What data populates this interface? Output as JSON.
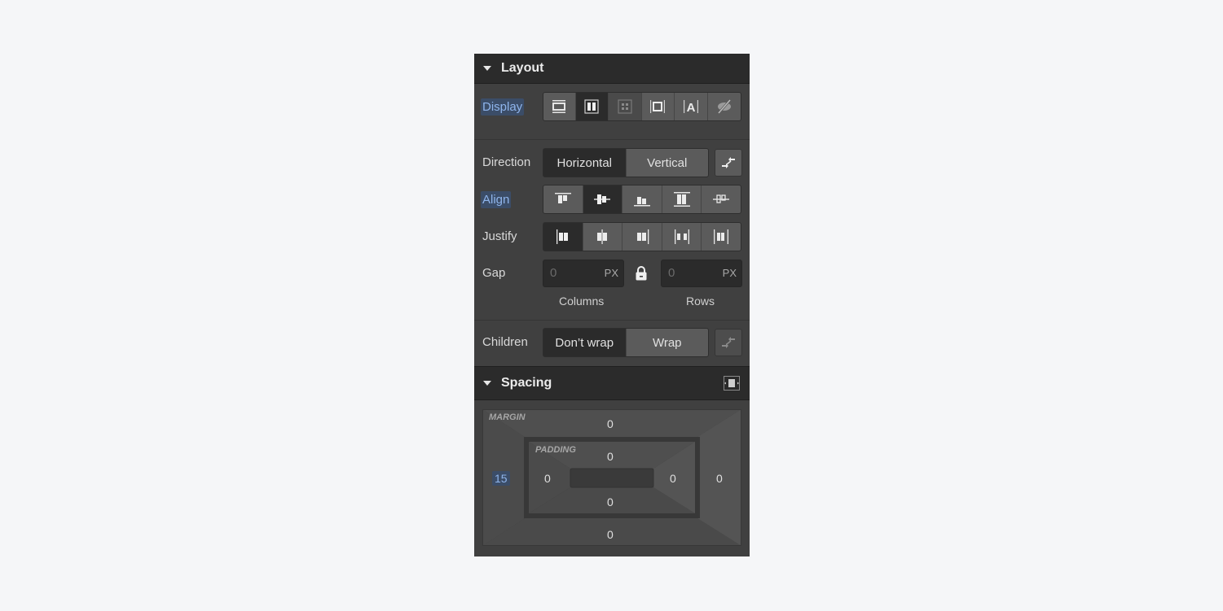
{
  "layout": {
    "title": "Layout",
    "display": {
      "label": "Display",
      "options": [
        {
          "name": "block",
          "icon": "display-block-icon",
          "active": false
        },
        {
          "name": "flex",
          "icon": "display-flex-icon",
          "active": true
        },
        {
          "name": "grid",
          "icon": "display-grid-icon",
          "active": false
        },
        {
          "name": "inline-block",
          "icon": "display-inline-block-icon",
          "active": false
        },
        {
          "name": "inline",
          "icon": "display-inline-icon",
          "active": false
        },
        {
          "name": "none",
          "icon": "display-none-icon",
          "active": false
        }
      ]
    },
    "direction": {
      "label": "Direction",
      "options": [
        "Horizontal",
        "Vertical"
      ],
      "selected": "Horizontal",
      "reverse_icon": "reverse-arrows-icon"
    },
    "align": {
      "label": "Align",
      "options": [
        {
          "name": "start",
          "icon": "align-start-icon",
          "active": false
        },
        {
          "name": "center",
          "icon": "align-center-icon",
          "active": true
        },
        {
          "name": "end",
          "icon": "align-end-icon",
          "active": false
        },
        {
          "name": "stretch",
          "icon": "align-stretch-icon",
          "active": false
        },
        {
          "name": "baseline",
          "icon": "align-baseline-icon",
          "active": false
        }
      ]
    },
    "justify": {
      "label": "Justify",
      "options": [
        {
          "name": "start",
          "icon": "justify-start-icon",
          "active": true
        },
        {
          "name": "center",
          "icon": "justify-center-icon",
          "active": false
        },
        {
          "name": "end",
          "icon": "justify-end-icon",
          "active": false
        },
        {
          "name": "space-between",
          "icon": "justify-space-between-icon",
          "active": false
        },
        {
          "name": "space-around",
          "icon": "justify-space-around-icon",
          "active": false
        }
      ]
    },
    "gap": {
      "label": "Gap",
      "columns": {
        "value": "0",
        "unit": "PX",
        "caption": "Columns"
      },
      "rows": {
        "value": "0",
        "unit": "PX",
        "caption": "Rows"
      },
      "lock_icon": "lock-icon"
    },
    "children": {
      "label": "Children",
      "options": [
        "Don’t wrap",
        "Wrap"
      ],
      "selected": "Don’t wrap",
      "reverse_icon": "reverse-arrows-icon"
    }
  },
  "spacing": {
    "title": "Spacing",
    "margin": {
      "caption": "MARGIN",
      "top": "0",
      "right": "0",
      "bottom": "0",
      "left": "15"
    },
    "padding": {
      "caption": "PADDING",
      "top": "0",
      "right": "0",
      "bottom": "0",
      "left": "0"
    }
  },
  "colors": {
    "highlight_bg": "#3b4d68",
    "highlight_text": "#8fb5ec",
    "panel_bg": "#404040",
    "header_bg": "#2b2b2b"
  }
}
